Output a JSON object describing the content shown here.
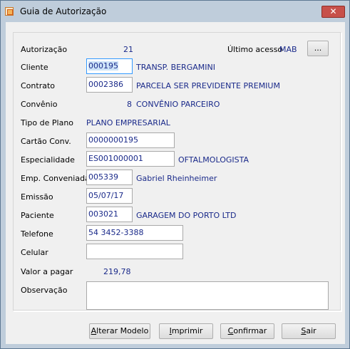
{
  "window": {
    "title": "Guia de Autorização",
    "close_symbol": "✕"
  },
  "form": {
    "autorizacao": {
      "label": "Autorização",
      "value": "21"
    },
    "ultimo_acesso": {
      "label": "Último acesso",
      "value": "MAB",
      "button": "..."
    },
    "cliente": {
      "label": "Cliente",
      "code": "000195",
      "name": "TRANSP. BERGAMINI"
    },
    "contrato": {
      "label": "Contrato",
      "code": "0002386",
      "name": "PARCELA SER PREVIDENTE PREMIUM"
    },
    "convenio": {
      "label": "Convênio",
      "code": "8",
      "name": "CONVÊNIO PARCEIRO"
    },
    "tipo_plano": {
      "label": "Tipo de Plano",
      "value": "PLANO EMPRESARIAL"
    },
    "cartao_conv": {
      "label": "Cartão Conv.",
      "value": "0000000195"
    },
    "especialidade": {
      "label": "Especialidade",
      "code": "ES001000001",
      "name": "OFTALMOLOGISTA"
    },
    "emp_conveniada": {
      "label": "Emp. Conveniada",
      "code": "005339",
      "name": "Gabriel Rheinheimer"
    },
    "emissao": {
      "label": "Emissão",
      "value": "05/07/17"
    },
    "paciente": {
      "label": "Paciente",
      "code": "003021",
      "name": "GARAGEM DO PORTO LTD"
    },
    "telefone": {
      "label": "Telefone",
      "value": "54 3452-3388"
    },
    "celular": {
      "label": "Celular",
      "value": ""
    },
    "valor_pagar": {
      "label": "Valor a pagar",
      "value": "219,78"
    },
    "observacao": {
      "label": "Observação",
      "value": ""
    }
  },
  "buttons": {
    "alterar_modelo": {
      "first": "A",
      "rest": "lterar Modelo"
    },
    "imprimir": {
      "first": "I",
      "rest": "mprimir"
    },
    "confirmar": {
      "first": "C",
      "rest": "onfirmar"
    },
    "sair": {
      "first": "S",
      "rest": "air"
    }
  },
  "colors": {
    "value_text": "#1a2a8a",
    "title_bar": "#bfcddb",
    "close_button": "#c7504a"
  }
}
